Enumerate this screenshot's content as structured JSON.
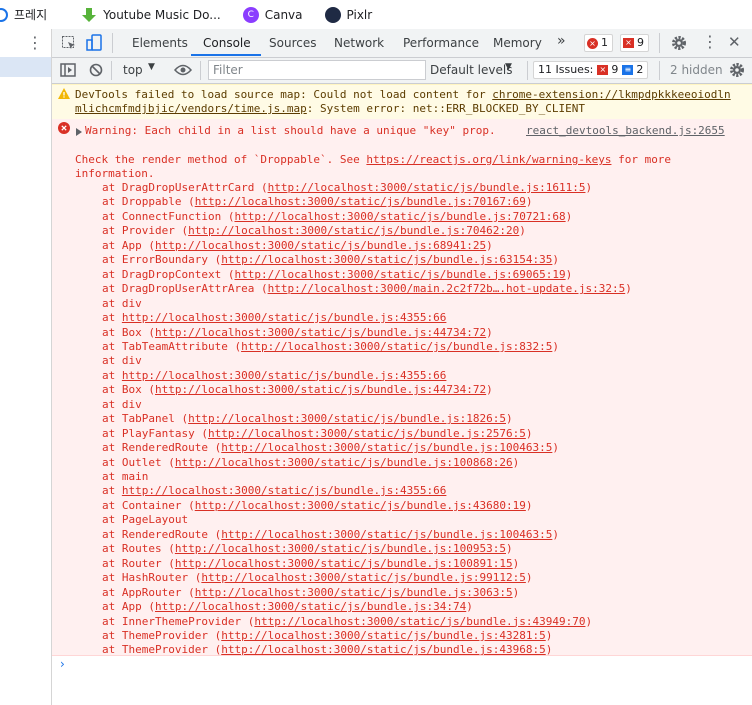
{
  "bookmarks": [
    {
      "label": "프레지",
      "color": "#1a73e8"
    },
    {
      "label": "Youtube Music Do...",
      "color": "#57b33a"
    },
    {
      "label": "Canva",
      "color": "#8b3dff"
    },
    {
      "label": "Pixlr",
      "color": "#1f2a44"
    }
  ],
  "tabs": {
    "elements": "Elements",
    "console": "Console",
    "sources": "Sources",
    "network": "Network",
    "performance": "Performance",
    "memory": "Memory",
    "more": "»"
  },
  "badges": {
    "errors": "1",
    "warnings": "9"
  },
  "toolbar": {
    "context": "top",
    "filter_placeholder": "Filter",
    "levels": "Default levels",
    "issues_label": "11 Issues:",
    "issues_errors": "9",
    "issues_info": "2",
    "hidden": "2 hidden"
  },
  "warning": {
    "line1": "DevTools failed to load source map: Could not load content for ",
    "link1": "chrome-extension://lkmpdpkkkeeoiodln",
    "link2": "mlichcmfmdjbjic/vendors/time.js.map",
    "line2": ": System error: net::ERR_BLOCKED_BY_CLIENT"
  },
  "error": {
    "header": "Warning: Each child in a list should have a unique \"key\" prop.",
    "source": "react_devtools_backend.js:2655",
    "check_prefix": "Check the render method of `Droppable`. See ",
    "check_link": "https://reactjs.org/link/warning-keys",
    "check_suffix": " for more",
    "check_line2": "information.",
    "frames": [
      {
        "name": "at DragDropUserAttrCard ",
        "url": "http://localhost:3000/static/js/bundle.js:1611:5"
      },
      {
        "name": "at Droppable ",
        "url": "http://localhost:3000/static/js/bundle.js:70167:69"
      },
      {
        "name": "at ConnectFunction ",
        "url": "http://localhost:3000/static/js/bundle.js:70721:68"
      },
      {
        "name": "at Provider ",
        "url": "http://localhost:3000/static/js/bundle.js:70462:20"
      },
      {
        "name": "at App ",
        "url": "http://localhost:3000/static/js/bundle.js:68941:25"
      },
      {
        "name": "at ErrorBoundary ",
        "url": "http://localhost:3000/static/js/bundle.js:63154:35"
      },
      {
        "name": "at DragDropContext ",
        "url": "http://localhost:3000/static/js/bundle.js:69065:19"
      },
      {
        "name": "at DragDropUserAttrArea ",
        "url": "http://localhost:3000/main.2c2f72b….hot-update.js:32:5"
      },
      {
        "name": "at div",
        "url": ""
      },
      {
        "name": "at ",
        "url": "http://localhost:3000/static/js/bundle.js:4355:66",
        "bare": true
      },
      {
        "name": "at Box ",
        "url": "http://localhost:3000/static/js/bundle.js:44734:72"
      },
      {
        "name": "at TabTeamAttribute ",
        "url": "http://localhost:3000/static/js/bundle.js:832:5"
      },
      {
        "name": "at div",
        "url": ""
      },
      {
        "name": "at ",
        "url": "http://localhost:3000/static/js/bundle.js:4355:66",
        "bare": true
      },
      {
        "name": "at Box ",
        "url": "http://localhost:3000/static/js/bundle.js:44734:72"
      },
      {
        "name": "at div",
        "url": ""
      },
      {
        "name": "at TabPanel ",
        "url": "http://localhost:3000/static/js/bundle.js:1826:5"
      },
      {
        "name": "at PlayFantasy ",
        "url": "http://localhost:3000/static/js/bundle.js:2576:5"
      },
      {
        "name": "at RenderedRoute ",
        "url": "http://localhost:3000/static/js/bundle.js:100463:5"
      },
      {
        "name": "at Outlet ",
        "url": "http://localhost:3000/static/js/bundle.js:100868:26"
      },
      {
        "name": "at main",
        "url": ""
      },
      {
        "name": "at ",
        "url": "http://localhost:3000/static/js/bundle.js:4355:66",
        "bare": true
      },
      {
        "name": "at Container ",
        "url": "http://localhost:3000/static/js/bundle.js:43680:19"
      },
      {
        "name": "at PageLayout",
        "url": ""
      },
      {
        "name": "at RenderedRoute ",
        "url": "http://localhost:3000/static/js/bundle.js:100463:5"
      },
      {
        "name": "at Routes ",
        "url": "http://localhost:3000/static/js/bundle.js:100953:5"
      },
      {
        "name": "at Router ",
        "url": "http://localhost:3000/static/js/bundle.js:100891:15"
      },
      {
        "name": "at HashRouter ",
        "url": "http://localhost:3000/static/js/bundle.js:99112:5"
      },
      {
        "name": "at AppRouter ",
        "url": "http://localhost:3000/static/js/bundle.js:3063:5"
      },
      {
        "name": "at App ",
        "url": "http://localhost:3000/static/js/bundle.js:34:74"
      },
      {
        "name": "at InnerThemeProvider ",
        "url": "http://localhost:3000/static/js/bundle.js:43949:70"
      },
      {
        "name": "at ThemeProvider ",
        "url": "http://localhost:3000/static/js/bundle.js:43281:5"
      },
      {
        "name": "at ThemeProvider ",
        "url": "http://localhost:3000/static/js/bundle.js:43968:5"
      }
    ]
  },
  "prompt": "›",
  "colors": {
    "error": "#d93025",
    "link_blue": "#1a73e8",
    "warning_bg": "#fffbe5",
    "error_bg": "#fff0f0"
  }
}
